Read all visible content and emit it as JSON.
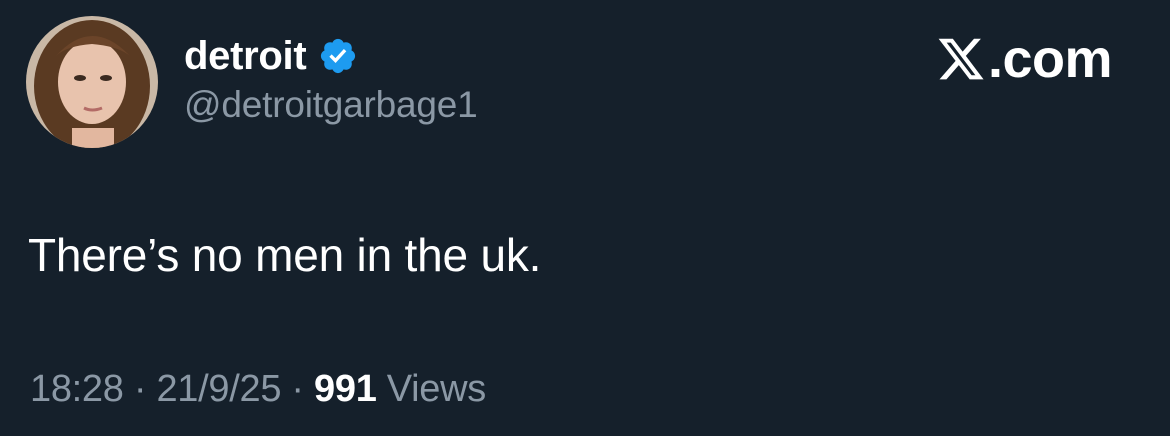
{
  "user": {
    "display_name": "detroit",
    "handle": "@detroitgarbage1",
    "verified_icon": "verified-badge-icon",
    "avatar_icon": "profile-photo"
  },
  "brand": {
    "label": ".com",
    "icon": "x-logo-icon"
  },
  "tweet": {
    "text": "There’s no men in the uk."
  },
  "meta": {
    "time": "18:28",
    "separator1": " · ",
    "date": "21/9/25",
    "separator2": " · ",
    "views_count": "991",
    "views_label": " Views"
  },
  "colors": {
    "background": "#15202b",
    "primary_text": "#ffffff",
    "secondary_text": "#8b98a5",
    "verified_blue": "#1d9bf0"
  }
}
